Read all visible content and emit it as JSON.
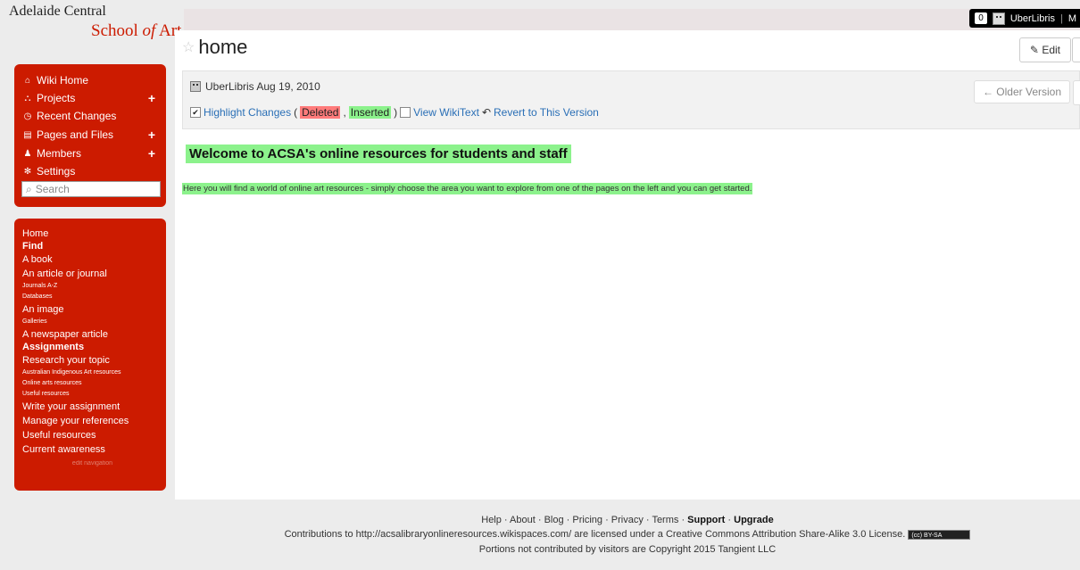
{
  "logo": {
    "line1": "Adelaide Central",
    "line2_pre": "School ",
    "line2_of": "of",
    "line2_post": " Art"
  },
  "userbar": {
    "count": "0",
    "username": "UberLibris",
    "sep": "|",
    "trail": "M"
  },
  "page": {
    "title": "home",
    "edit_label": "Edit"
  },
  "version": {
    "author_date": "UberLibris Aug 19, 2010",
    "older_label": "Older Version",
    "highlight_label": "Highlight Changes",
    "deleted": "Deleted",
    "inserted": "Inserted",
    "view_wikitext": "View WikiText",
    "revert": "Revert to This Version"
  },
  "content": {
    "heading": "Welcome to ACSA's online resources for students and staff",
    "intro": "Here you will find a world of online art resources - simply choose the area you want to explore from one of the pages on the left and you can get started."
  },
  "sidebar": {
    "menu": [
      {
        "label": "Wiki Home",
        "icon": "home-icon",
        "plus": false
      },
      {
        "label": "Projects",
        "icon": "sitemap-icon",
        "plus": true
      },
      {
        "label": "Recent Changes",
        "icon": "clock-icon",
        "plus": false
      },
      {
        "label": "Pages and Files",
        "icon": "file-icon",
        "plus": true
      },
      {
        "label": "Members",
        "icon": "user-icon",
        "plus": true
      },
      {
        "label": "Settings",
        "icon": "gear-icon",
        "plus": false
      }
    ],
    "search_placeholder": "Search",
    "nav": [
      {
        "text": "Home",
        "style": "big"
      },
      {
        "text": "Find",
        "style": "bold"
      },
      {
        "text": "A book",
        "style": "big"
      },
      {
        "text": "An article or journal",
        "style": "big"
      },
      {
        "text": "Journals A-Z",
        "style": "small"
      },
      {
        "text": "Databases",
        "style": "small"
      },
      {
        "text": "An image",
        "style": "big"
      },
      {
        "text": "Galleries",
        "style": "small"
      },
      {
        "text": "A newspaper article",
        "style": "big"
      },
      {
        "text": "Assignments",
        "style": "bold"
      },
      {
        "text": "Research your topic",
        "style": "big"
      },
      {
        "text": "Australian Indigenous Art resources",
        "style": "small"
      },
      {
        "text": "Online arts resources",
        "style": "small"
      },
      {
        "text": "Useful resources",
        "style": "small"
      },
      {
        "text": "Write your assignment",
        "style": "big"
      },
      {
        "text": "Manage your references",
        "style": "big"
      },
      {
        "text": "Useful resources",
        "style": "big"
      },
      {
        "text": "Current awareness",
        "style": "big"
      }
    ],
    "edit_navigation": "edit navigation"
  },
  "footer": {
    "links": [
      "Help",
      "About",
      "Blog",
      "Pricing",
      "Privacy",
      "Terms"
    ],
    "support": "Support",
    "upgrade": "Upgrade",
    "license": "Contributions to http://acsalibraryonlineresources.wikispaces.com/ are licensed under a Creative Commons Attribution Share-Alike 3.0 License.",
    "cc_badge": "(cc) BY-SA",
    "copyright": "Portions not contributed by visitors are Copyright 2015 Tangient LLC"
  },
  "colors": {
    "brand_red": "#cc1b00",
    "highlight_green": "#8cf28c",
    "deleted_red": "#ff7b7b",
    "link_blue": "#2a6fb6"
  }
}
